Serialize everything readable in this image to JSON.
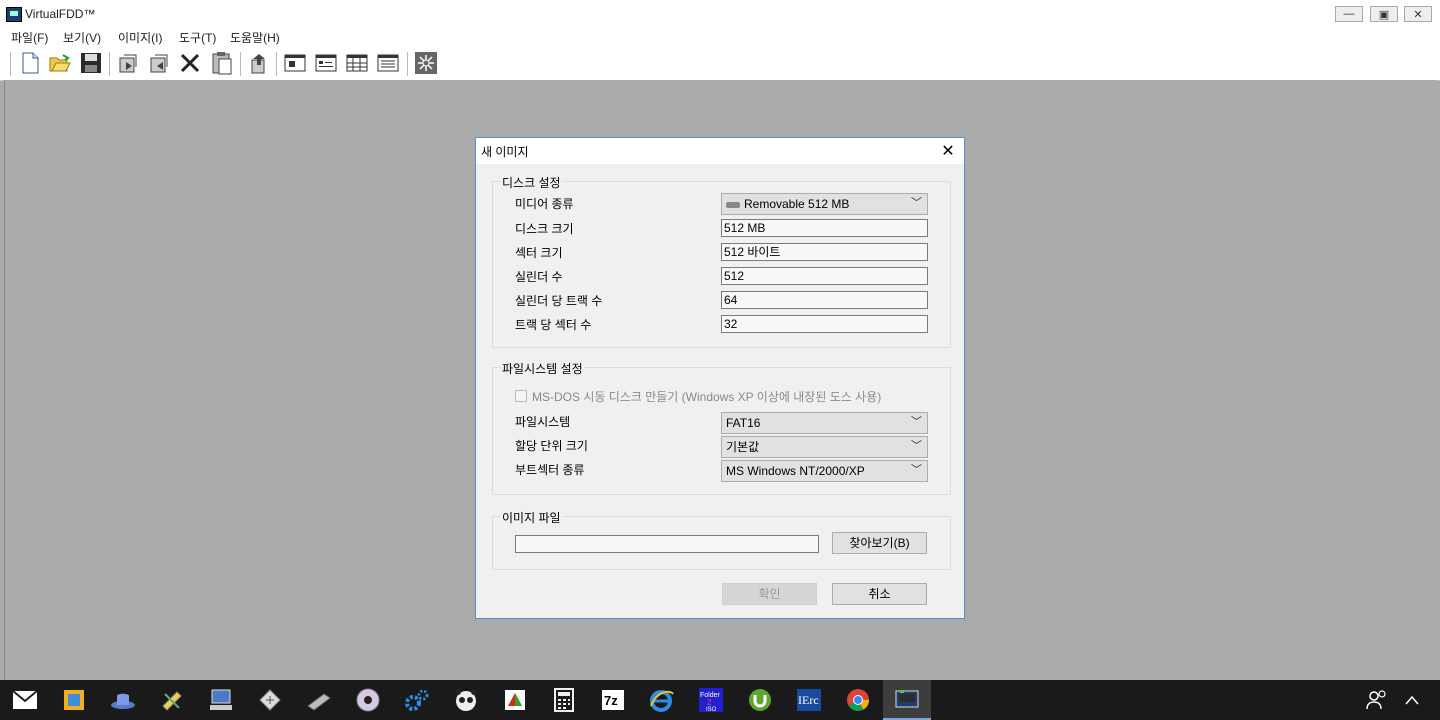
{
  "window": {
    "title": "VirtualFDD™",
    "minimize_icon": "minimize-icon",
    "maximize_icon": "restore-icon",
    "close_icon": "close-icon"
  },
  "menu": [
    "파일(F)",
    "보기(V)",
    "이미지(I)",
    "도구(T)",
    "도움말(H)"
  ],
  "toolbar": [
    "new-icon",
    "open-icon",
    "save-icon",
    "extract-icon",
    "insert-icon",
    "delete-icon",
    "paste-icon",
    "export-icon",
    "view-large-icon",
    "view-small-icon",
    "view-list-icon",
    "view-detail-icon",
    "settings-icon"
  ],
  "dialog": {
    "title": "새 이미지",
    "disk": {
      "group_label": "디스크 설정",
      "media_label": "미디어 종류",
      "media_value": "Removable 512 MB",
      "size_label": "디스크 크기",
      "size_value": "512 MB",
      "sector_label": "섹터 크기",
      "sector_value": "512 바이트",
      "cyl_label": "실린더 수",
      "cyl_value": "512",
      "tpc_label": "실린더 당 트랙 수",
      "tpc_value": "64",
      "spt_label": "트랙 당 섹터 수",
      "spt_value": "32"
    },
    "fs": {
      "group_label": "파일시스템 설정",
      "msdos_label": "MS-DOS 시동 디스크 만들기 (Windows XP 이상에 내장된 도스 사용)",
      "fs_label": "파일시스템",
      "fs_value": "FAT16",
      "cluster_label": "할당 단위 크기",
      "cluster_value": "기본값",
      "boot_label": "부트섹터 종류",
      "boot_value": "MS Windows NT/2000/XP"
    },
    "image": {
      "group_label": "이미지 파일",
      "path_value": "",
      "browse_label": "찾아보기(B)"
    },
    "ok_label": "확인",
    "cancel_label": "취소"
  },
  "taskbar": {
    "apps": [
      "mail-icon",
      "explorer-icon",
      "hat-icon",
      "scroll-icon",
      "computer-icon",
      "tag-icon",
      "usb-icon",
      "disc-icon",
      "gear-icon",
      "panda-icon",
      "office-icon",
      "calculator-icon",
      "7zip-icon",
      "ie-icon",
      "folder2iso-icon",
      "utorrent-icon",
      "ierc-icon",
      "chrome-icon",
      "virtualfdd-icon"
    ],
    "tray": [
      "people-icon",
      "chevron-up-icon"
    ]
  },
  "colors": {
    "workspace": "#ababab",
    "dialog_border": "#5a8fc9",
    "taskbar": "#1a1a1a"
  }
}
